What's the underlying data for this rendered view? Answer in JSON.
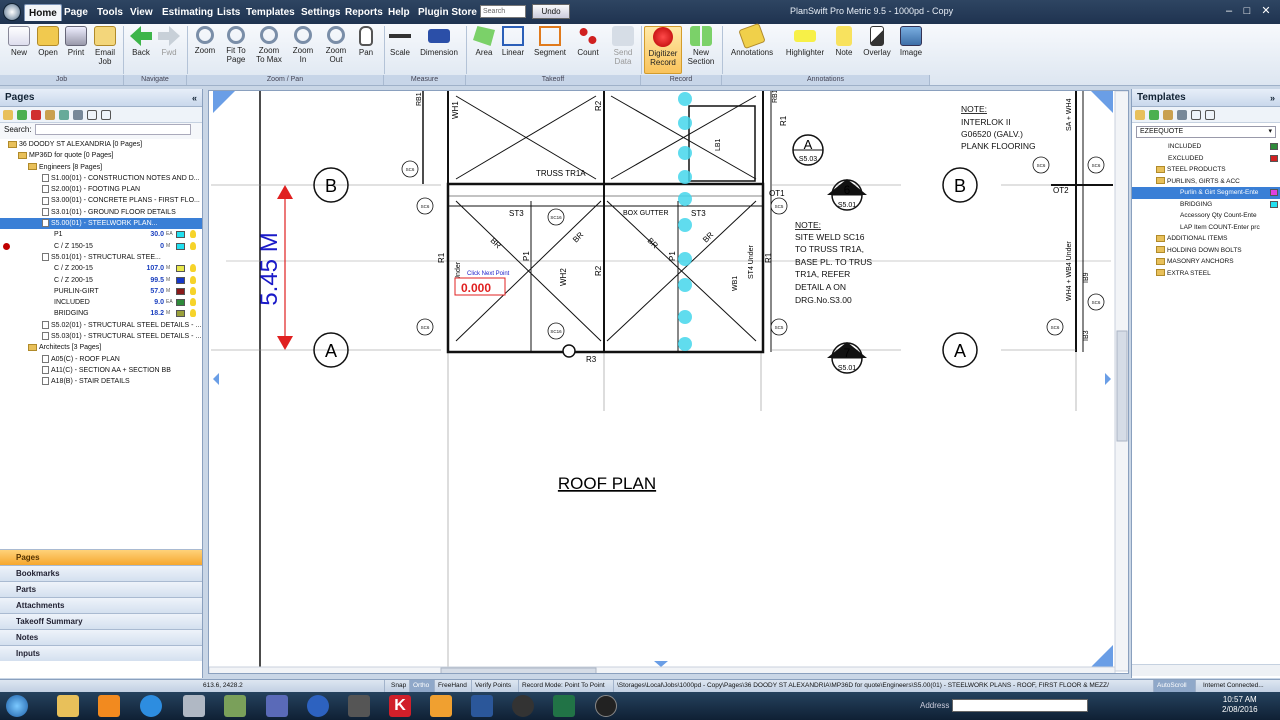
{
  "menu": {
    "items": [
      "Home",
      "Page",
      "Tools",
      "View",
      "Estimating",
      "Lists",
      "Templates",
      "Settings",
      "Reports",
      "Help",
      "Plugin Store"
    ],
    "search_placeholder": "Search",
    "undo": "Undo",
    "app_title": "PlanSwift Pro Metric 9.5 - 1000pd - Copy"
  },
  "ribbon": {
    "buttons": {
      "new": "New",
      "open": "Open",
      "print": "Print",
      "email": "Email\nJob",
      "back": "Back",
      "fwd": "Fwd",
      "zoom": "Zoom",
      "fit": "Fit To\nPage",
      "max": "Zoom\nTo Max",
      "zin": "Zoom\nIn",
      "zout": "Zoom\nOut",
      "pan": "Pan",
      "scale": "Scale",
      "dimension": "Dimension",
      "area": "Area",
      "linear": "Linear",
      "segment": "Segment",
      "count": "Count",
      "senddata": "Send\nData",
      "digitizer": "Digitizer\nRecord",
      "newsection": "New\nSection",
      "annotations": "Annotations",
      "highlighter": "Highlighter",
      "note": "Note",
      "overlay": "Overlay",
      "image": "Image"
    },
    "groups": {
      "job": "Job",
      "navigate": "Navigate",
      "zoompan": "Zoom / Pan",
      "measure": "Measure",
      "takeoff": "Takeoff",
      "record": "Record",
      "annotations": "Annotations"
    }
  },
  "pages_panel": {
    "title": "Pages",
    "search_label": "Search:",
    "tree": [
      "36 DOODY ST ALEXANDRIA [0 Pages]",
      "MP36D for quote [0 Pages]",
      "Engineers [8 Pages]",
      "S1.00(01) - CONSTRUCTION NOTES AND D...",
      "S2.00(01) - FOOTING PLAN",
      "S3.00(01) - CONCRETE PLANS - FIRST FLO...",
      "S3.01(01) - GROUND FLOOR DETAILS",
      "S5.00(01) - STEELWORK PLAN...",
      "P1",
      "C / Z 150-15",
      "S5.01(01) - STRUCTURAL STEE...",
      "C / Z 200-15",
      "C / Z 200-15",
      "PURLIN-GIRT",
      "INCLUDED",
      "BRIDGING",
      "S5.02(01) - STRUCTURAL STEEL DETAILS - ...",
      "S5.03(01) - STRUCTURAL STEEL DETAILS - ...",
      "Architects [3 Pages]",
      "A05(C) - ROOF PLAN",
      "A11(C) - SECTION AA + SECTION BB",
      "A18(B) - STAIR DETAILS"
    ],
    "values": {
      "p1": "30.0",
      "p1_unit": "EA",
      "cz150": "0",
      "cz150_unit": "M",
      "cz200a": "107.0",
      "cz200a_unit": "M",
      "cz200b": "99.5",
      "cz200b_unit": "M",
      "purlin": "57.0",
      "purlin_unit": "M",
      "included": "9.0",
      "included_unit": "EA",
      "bridging": "18.2",
      "bridging_unit": "M"
    },
    "colors": {
      "p1": "#22e0f0",
      "cz150": "#22e0f0",
      "cz200a": "#e8e84a",
      "cz200b": "#1638c8",
      "purlin": "#8a1a1a",
      "included": "#2e8a3a",
      "bridging": "#9aa03a"
    },
    "nav": [
      "Pages",
      "Bookmarks",
      "Parts",
      "Attachments",
      "Takeoff Summary",
      "Notes",
      "Inputs"
    ]
  },
  "drawing": {
    "dimension": "5.45 M",
    "grid_b": "B",
    "grid_a": "A",
    "title": "ROOF PLAN",
    "truss": "TRUSS TR1A",
    "box_gutter": "BOX GUTTER",
    "st3": "ST3",
    "br": "BR",
    "r1": "R1",
    "r2": "R2",
    "r3": "R3",
    "p1": "P1",
    "wh2": "WH2",
    "wb1": "WB1",
    "lb1": "LB1",
    "ot1": "OT1",
    "ot2": "OT2",
    "rb1": "RB1",
    "wh1": "WH1",
    "st4_under": "ST4 Under",
    "wh4_under": "WH4 + WB4 Under",
    "sa_wh4": "SA + WH4",
    "ib9": "IB9",
    "ib3": "IB3",
    "under": "Under",
    "sc6": "SC6",
    "sc16": "SC16",
    "sc5": "SC5",
    "click_next": "Click Next Point",
    "measure_value": "0.000",
    "detail_a": "A",
    "detail_a_ref": "S5.03",
    "detail_6": "6",
    "detail_6_ref": "S5.01",
    "detail_7": "7",
    "detail_7_ref": "S5.01",
    "note1": [
      "NOTE:",
      "INTERLOK II",
      "G06520 (GALV.)",
      "PLANK FLOORING"
    ],
    "note2": [
      "NOTE:",
      "SITE WELD SC16",
      "TO TRUSS TR1A,",
      "BASE PL. TO TRUS",
      "TR1A, REFER",
      "DETAIL A ON",
      "DRG.No.S3.00"
    ]
  },
  "templates_panel": {
    "title": "Templates",
    "dropdown": "EZEEQUOTE",
    "tree": [
      "INCLUDED",
      "EXCLUDED",
      "STEEL PRODUCTS",
      "PURLINS, GIRTS & ACC",
      "Purlin & Girt Segment-Ente",
      "BRIDGING",
      "Accessory Qty Count-Ente",
      "LAP Item COUNT-Enter prc",
      "ADDITIONAL ITEMS",
      "HOLDING DOWN BOLTS",
      "MASONRY ANCHORS",
      "EXTRA STEEL"
    ]
  },
  "status": {
    "coords": "613.6, 2428.2",
    "snap": "Snap",
    "ortho": "Ortho",
    "freehand": "FreeHand",
    "verify": "Verify Points",
    "record_mode": "Record Mode: Point To Point",
    "path": "\\Storages\\Local\\Jobs\\1000pd - Copy\\Pages\\36 DOODY ST ALEXANDRIA\\MP36D for quote\\Engineers\\S5.00(01) - STEELWORK PLANS - ROOF, FIRST FLOOR & MEZZ/",
    "autoscroll": "AutoScroll",
    "internet": "Internet Connected..."
  },
  "taskbar": {
    "address_label": "Address",
    "time": "10:57 AM",
    "date": "2/08/2016"
  }
}
